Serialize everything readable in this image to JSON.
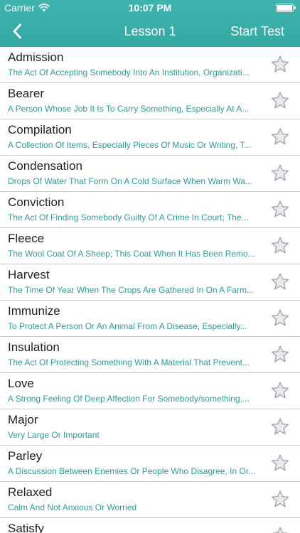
{
  "status_bar": {
    "carrier": "Carrier",
    "time": "10:07 PM"
  },
  "nav": {
    "title": "Lesson 1",
    "action": "Start Test"
  },
  "colors": {
    "header": "#3bafa9",
    "definition_text": "#2e9d96",
    "star_fill": "#e9e9ee",
    "star_stroke": "#a5a5ab"
  },
  "words": [
    {
      "title": "Admission",
      "definition": "The Act Of Accepting Somebody Into An Institution, Organizati..."
    },
    {
      "title": "Bearer",
      "definition": "A Person Whose Job It Is To Carry Something, Especially At A..."
    },
    {
      "title": "Compilation",
      "definition": "A Collection Of Items, Especially Pieces Of Music Or Writing, T..."
    },
    {
      "title": "Condensation",
      "definition": "Drops Of Water That Form On A Cold Surface When Warm Wa..."
    },
    {
      "title": "Conviction",
      "definition": "The Act Of Finding Somebody Guilty Of A Crime In Court; The..."
    },
    {
      "title": "Fleece",
      "definition": "The Wool Coat Of A Sheep; This Coat When It Has Been Remo..."
    },
    {
      "title": "Harvest",
      "definition": "The Time Of Year When The Crops Are Gathered In On A Farm..."
    },
    {
      "title": "Immunize",
      "definition": "To Protect A Person Or An Animal From A Disease, Especially..."
    },
    {
      "title": "Insulation",
      "definition": "The Act Of Protecting Something With A Material That Prevent..."
    },
    {
      "title": "Love",
      "definition": "A Strong Feeling Of Deep Affection For Somebody/something,..."
    },
    {
      "title": "Major",
      "definition": "Very Large Or Important"
    },
    {
      "title": "Parley",
      "definition": "A Discussion Between Enemies Or People Who Disagree, In Or..."
    },
    {
      "title": "Relaxed",
      "definition": "Calm And Not Anxious Or Worried"
    },
    {
      "title": "Satisfy",
      "definition": ""
    }
  ]
}
